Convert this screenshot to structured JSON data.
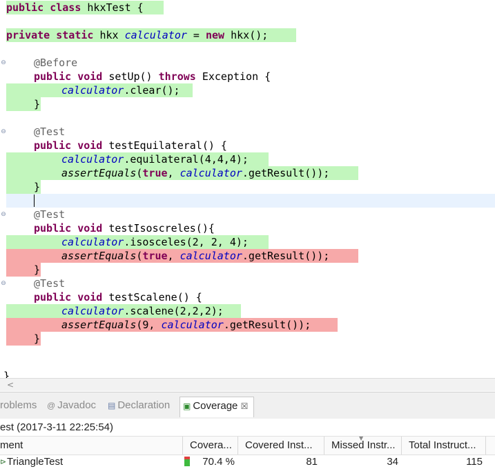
{
  "editor": {
    "lines": {
      "l1": {
        "kw1": "public",
        "kw2": "class",
        "rest": " hkxTest {"
      },
      "l3": {
        "kw1": "private",
        "kw2": "static",
        "t1": " hkx ",
        "field": "calculator",
        "t2": " = ",
        "kw3": "new",
        "t3": " hkx();"
      },
      "l5": {
        "ann": "@Before"
      },
      "l6": {
        "kw1": "public",
        "kw2": "void",
        "t1": " setUp() ",
        "kw3": "throws",
        "t2": " Exception {"
      },
      "l7": {
        "field": "calculator",
        "rest": ".clear();"
      },
      "l8": {
        "brace": "}"
      },
      "l10": {
        "ann": "@Test"
      },
      "l11": {
        "kw1": "public",
        "kw2": "void",
        "rest": " testEquilateral() {"
      },
      "l12": {
        "field": "calculator",
        "rest": ".equilateral(4,4,4);"
      },
      "l13": {
        "st": "assertEquals",
        "p1": "(",
        "kw": "true",
        "p2": ", ",
        "field": "calculator",
        "rest": ".getResult());"
      },
      "l14": {
        "brace": "}"
      },
      "l16": {
        "ann": "@Test"
      },
      "l17": {
        "kw1": "public",
        "kw2": "void",
        "rest": " testIsoscreles(){"
      },
      "l18": {
        "field": "calculator",
        "rest": ".isosceles(2, 2, 4);"
      },
      "l19": {
        "st": "assertEquals",
        "p1": "(",
        "kw": "true",
        "p2": ", ",
        "field": "calculator",
        "rest": ".getResult());"
      },
      "l20": {
        "brace": "}"
      },
      "l21": {
        "ann": "@Test"
      },
      "l22": {
        "kw1": "public",
        "kw2": "void",
        "rest": " testScalene() {"
      },
      "l23": {
        "field": "calculator",
        "rest": ".scalene(2,2,2);"
      },
      "l24": {
        "st": "assertEquals",
        "p1": "(9, ",
        "field": "calculator",
        "rest": ".getResult());"
      },
      "l25": {
        "brace": "}"
      },
      "l28": {
        "brace": "}"
      }
    },
    "fold_marker": "⊖",
    "scroll_left": "<"
  },
  "panel": {
    "tabs": [
      {
        "label": "roblems",
        "icon": "problems-icon"
      },
      {
        "label": "Javadoc",
        "icon": "javadoc-icon",
        "glyph": "@"
      },
      {
        "label": "Declaration",
        "icon": "declaration-icon",
        "glyph": "▤"
      },
      {
        "label": "Coverage",
        "icon": "coverage-icon",
        "glyph": "▣",
        "close": "☒"
      }
    ],
    "session": "est (2017-3-11 22:25:54)",
    "columns": [
      "ment",
      "Covera...",
      "Covered Inst...",
      "Missed Instr...",
      "Total Instruct..."
    ],
    "rows": [
      {
        "name": "TriangleTest",
        "coverage": "70.4 %",
        "coverage_fraction": 0.704,
        "covered": "81",
        "missed": "34",
        "total": "115"
      }
    ]
  },
  "colors": {
    "covered": "#c2f6bd",
    "missed": "#f7a9a9",
    "keyword": "#7f0055",
    "field": "#0000c0"
  }
}
